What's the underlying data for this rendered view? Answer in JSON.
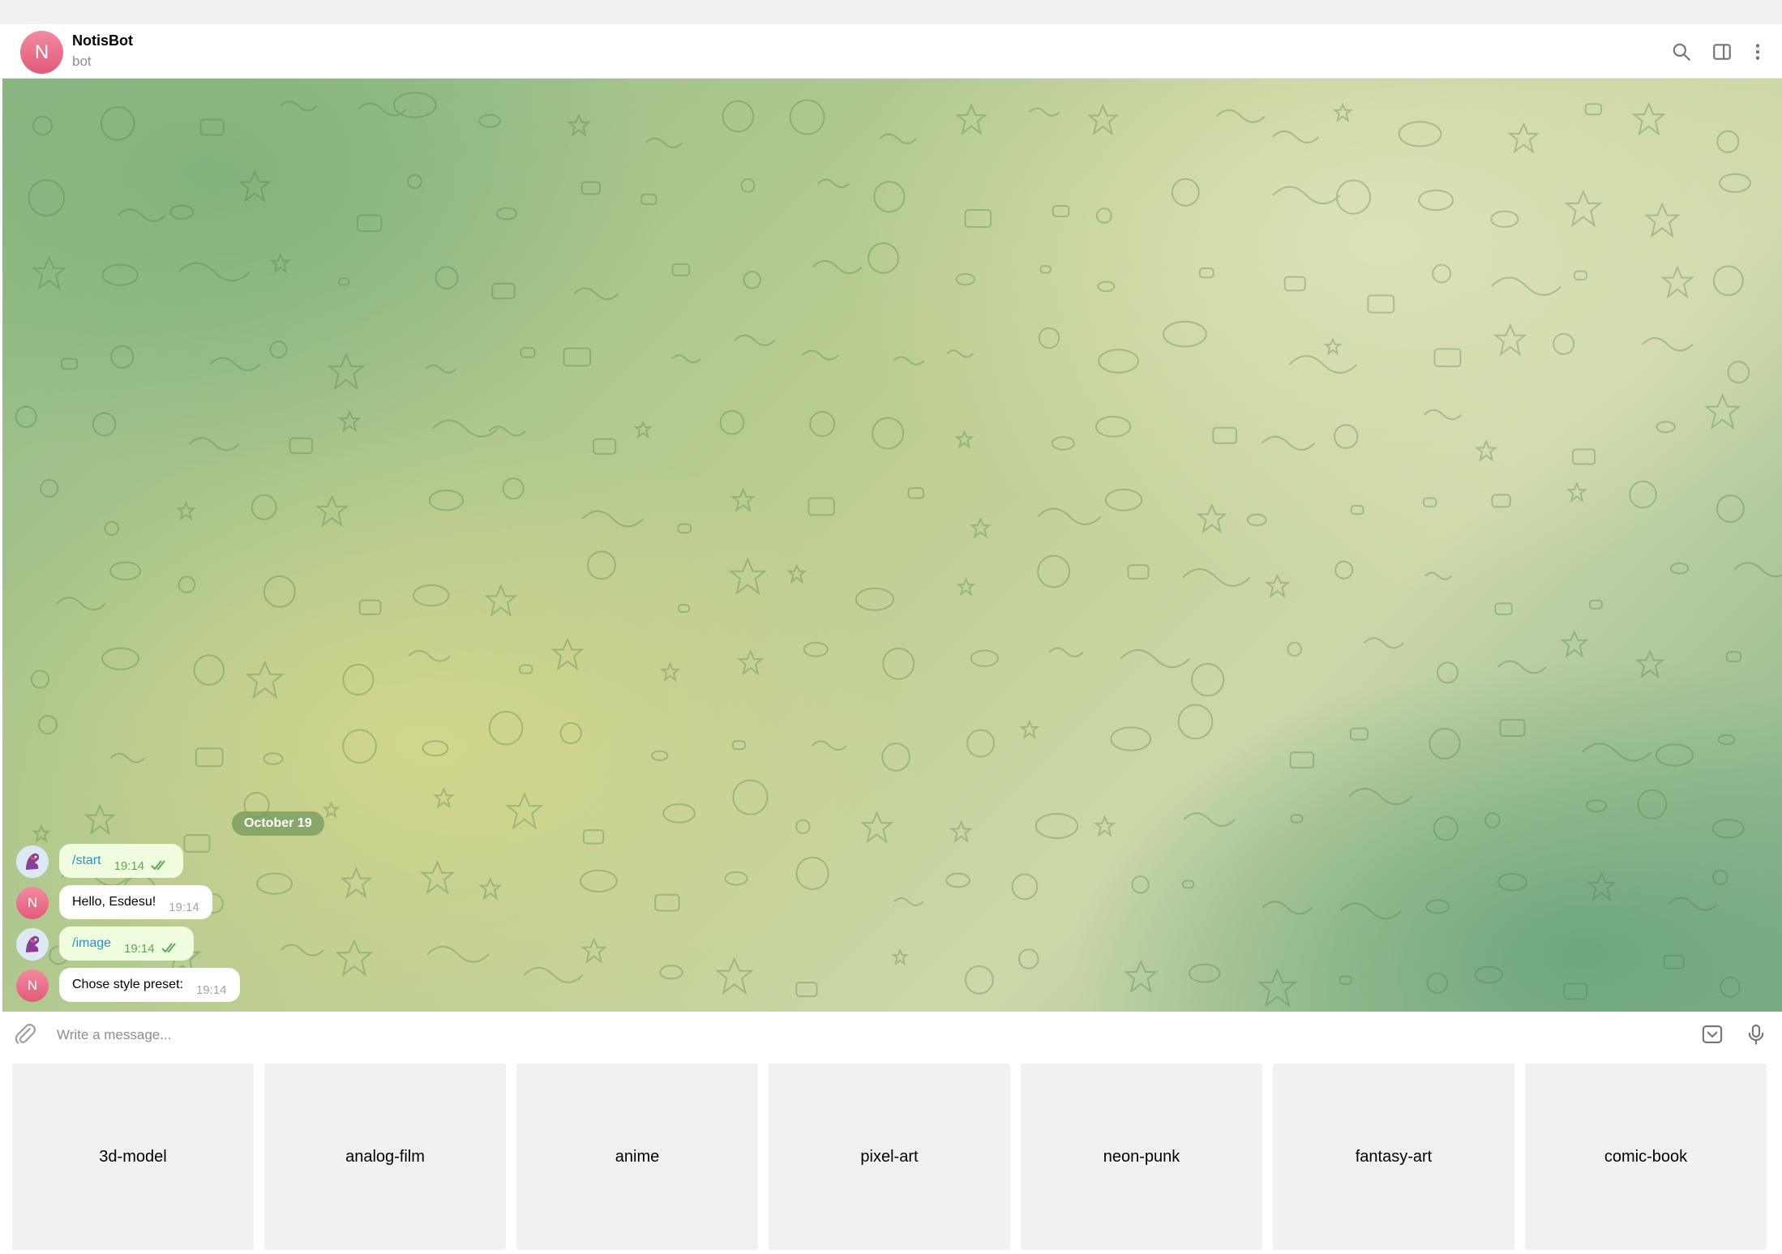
{
  "header": {
    "avatar_letter": "N",
    "name": "NotisBot",
    "status": "bot",
    "icons": [
      "search-icon",
      "sidebar-toggle-icon",
      "more-vertical-icon"
    ]
  },
  "chat": {
    "date_label": "October 19",
    "messages": [
      {
        "direction": "out",
        "text": "/start",
        "time": "19:14",
        "is_command": true
      },
      {
        "direction": "in",
        "avatar_letter": "N",
        "text": "Hello, Esdesu!",
        "time": "19:14"
      },
      {
        "direction": "out",
        "text": "/image",
        "time": "19:14",
        "is_command": true
      },
      {
        "direction": "in",
        "avatar_letter": "N",
        "text": "Chose style preset:",
        "time": "19:14"
      }
    ]
  },
  "composer": {
    "placeholder": "Write a message...",
    "icons": [
      "attach-icon",
      "keyboard-toggle-icon",
      "microphone-icon"
    ]
  },
  "keyboard": {
    "buttons": [
      "3d-model",
      "analog-film",
      "anime",
      "pixel-art",
      "neon-punk",
      "fantasy-art",
      "comic-book"
    ]
  },
  "colors": {
    "avatar_pink": "#e15a7a",
    "outgoing_bubble": "#effdde",
    "incoming_bubble": "#ffffff",
    "command_link": "#2b8fd6",
    "read_check": "#5fa855"
  }
}
